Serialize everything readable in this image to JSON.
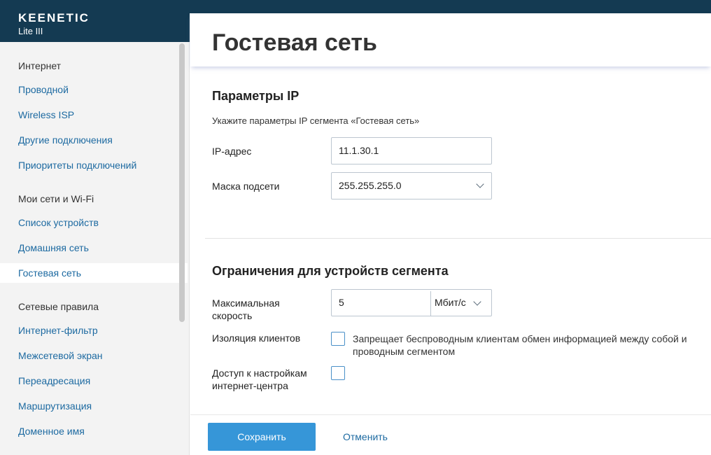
{
  "brand": {
    "name": "KEENETIC",
    "model": "Lite III"
  },
  "sidebar": {
    "items": [
      {
        "label": "Интернет",
        "type": "header"
      },
      {
        "label": "Проводной",
        "type": "link"
      },
      {
        "label": "Wireless ISP",
        "type": "link"
      },
      {
        "label": "Другие подключения",
        "type": "link"
      },
      {
        "label": "Приоритеты подключений",
        "type": "link"
      },
      {
        "label": "Мои сети и Wi-Fi",
        "type": "header"
      },
      {
        "label": "Список устройств",
        "type": "link"
      },
      {
        "label": "Домашняя сеть",
        "type": "link"
      },
      {
        "label": "Гостевая сеть",
        "type": "active"
      },
      {
        "label": "Сетевые правила",
        "type": "header"
      },
      {
        "label": "Интернет-фильтр",
        "type": "link"
      },
      {
        "label": "Межсетевой экран",
        "type": "link"
      },
      {
        "label": "Переадресация",
        "type": "link"
      },
      {
        "label": "Маршрутизация",
        "type": "link"
      },
      {
        "label": "Доменное имя",
        "type": "link"
      }
    ]
  },
  "page": {
    "title": "Гостевая сеть"
  },
  "ip_section": {
    "title": "Параметры IP",
    "hint": "Укажите параметры IP сегмента «Гостевая сеть»",
    "ip_label": "IP-адрес",
    "ip_value": "11.1.30.1",
    "mask_label": "Маска подсети",
    "mask_value": "255.255.255.0"
  },
  "limits_section": {
    "title": "Ограничения для устройств сегмента",
    "speed_label": "Максимальная скорость",
    "speed_value": "5",
    "speed_unit": "Мбит/с",
    "isolation_label": "Изоляция клиентов",
    "isolation_desc": "Запрещает беспроводным клиентам обмен информацией между собой и проводным сегментом",
    "isolation_checked": false,
    "access_label": "Доступ к настройкам интернет-центра",
    "access_checked": false
  },
  "actions": {
    "save": "Сохранить",
    "cancel": "Отменить"
  },
  "colors": {
    "brand": "#143a52",
    "accent": "#3696d8",
    "link": "#1d6aa1"
  }
}
